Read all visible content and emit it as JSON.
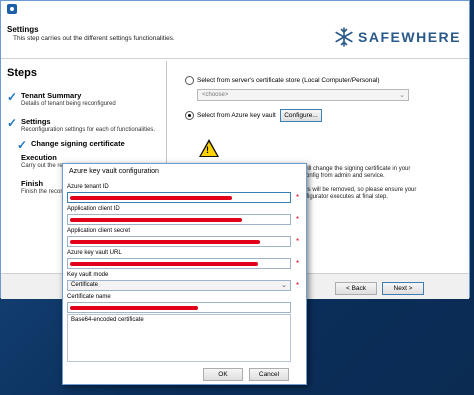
{
  "header": {
    "title": "Settings",
    "subtitle": "This step carries out the different settings functionalities.",
    "brand": "SAFEWHERE"
  },
  "steps": {
    "title": "Steps",
    "items": [
      {
        "name": "Tenant Summary",
        "desc": "Details of tenant being reconfigured"
      },
      {
        "name": "Settings",
        "desc": "Reconfiguration settings for each of functionalities."
      },
      {
        "name": "Change signing certificate",
        "desc": ""
      },
      {
        "name": "Execution",
        "desc": "Carry out the re"
      },
      {
        "name": "Finish",
        "desc": "Finish the recor"
      }
    ]
  },
  "options": {
    "store_label": "Select from server's certificate store (Local Computer/Personal)",
    "store_placeholder": "<choose>",
    "azure_label": "Select from Azure key vault",
    "configure_button": "Configure..."
  },
  "warning": {
    "line1": "will change the signing certificate in your",
    "line2": "config from admin and service.",
    "line3": "les will be removed, so please ensure your",
    "line4": "nfigurator executes at final step."
  },
  "footer": {
    "back_button": "< Back",
    "next_button": "Next >"
  },
  "dialog": {
    "title": "Azure key vault configuration",
    "tenant_id_label": "Azure tenant ID",
    "client_id_label": "Application client ID",
    "client_secret_label": "Application client secret",
    "vault_url_label": "Azure key vault URL",
    "key_vault_mode_label": "Key vault mode",
    "key_vault_mode_value": "Certificate",
    "certificate_name_label": "Certificate name",
    "base64_label": "Base64-encoded certificate",
    "ok_button": "OK",
    "cancel_button": "Cancel",
    "required_marker": "*"
  },
  "colors": {
    "accent": "#1b75c4",
    "brand": "#2a5a8a",
    "redaction": "#e2001a",
    "warning": "#ffd400"
  }
}
